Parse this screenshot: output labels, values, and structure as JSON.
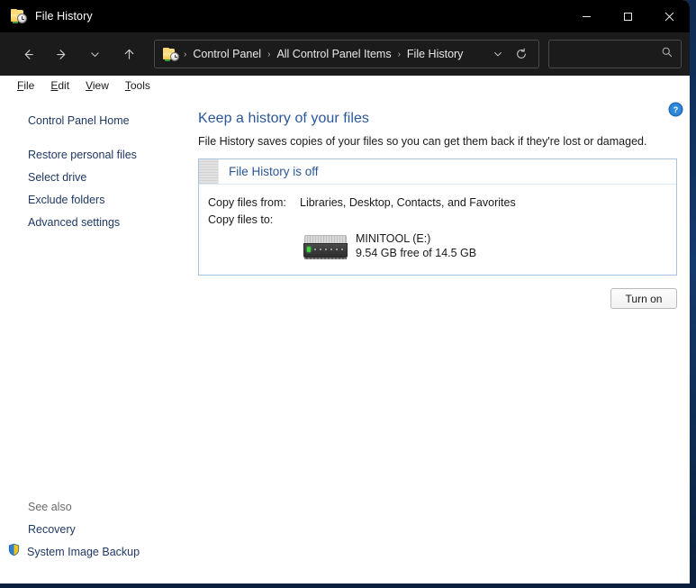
{
  "window": {
    "title": "File History",
    "app_icon": "file-history-folder-clock-icon",
    "controls": {
      "minimize": "Minimize",
      "maximize": "Maximize",
      "close": "Close"
    }
  },
  "nav": {
    "back": "Back",
    "forward": "Forward",
    "recent": "Recent locations",
    "up": "Up",
    "refresh": "Refresh",
    "breadcrumb_dropdown": "Previous locations",
    "breadcrumbs": [
      "Control Panel",
      "All Control Panel Items",
      "File History"
    ],
    "separator": "›"
  },
  "search": {
    "value": "",
    "placeholder": "",
    "icon": "search-icon"
  },
  "menubar": {
    "items": [
      {
        "accel": "F",
        "rest": "ile"
      },
      {
        "accel": "E",
        "rest": "dit"
      },
      {
        "accel": "V",
        "rest": "iew"
      },
      {
        "accel": "T",
        "rest": "ools"
      }
    ]
  },
  "sidebar": {
    "home": "Control Panel Home",
    "items": [
      "Restore personal files",
      "Select drive",
      "Exclude folders",
      "Advanced settings"
    ],
    "see_also_title": "See also",
    "see_also": [
      {
        "label": "Recovery",
        "icon": null
      },
      {
        "label": "System Image Backup",
        "icon": "uac-shield-icon"
      }
    ]
  },
  "main": {
    "help": "?",
    "title": "Keep a history of your files",
    "description": "File History saves copies of your files so you can get them back if they're lost or damaged.",
    "status": {
      "text": "File History is off",
      "state": "off"
    },
    "rows": [
      {
        "label": "Copy files from:",
        "value": "Libraries, Desktop, Contacts, and Favorites"
      },
      {
        "label": "Copy files to:",
        "value": ""
      }
    ],
    "drive": {
      "icon": "external-hard-drive-icon",
      "name": "MINITOOL (E:)",
      "capacity": "9.54 GB free of 14.5 GB"
    },
    "primary_button": "Turn on"
  },
  "colors": {
    "titlebar_bg": "#000000",
    "navbar_bg": "#1b1b1b",
    "accent_blue": "#2b5797",
    "link_blue": "#1f3864",
    "panel_border": "#a8c3e0",
    "desktop_bg": "#123a6b",
    "drive_led": "#3fd13f"
  }
}
